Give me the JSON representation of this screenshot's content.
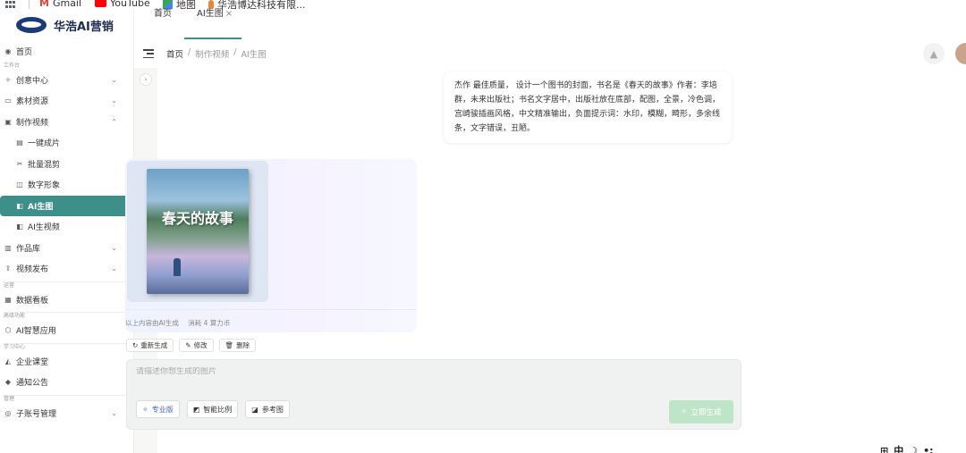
{
  "bookmarks": [
    {
      "label": "Gmail",
      "icon": "gmail-icon",
      "color": "#ea4335"
    },
    {
      "label": "YouTube",
      "icon": "youtube-icon",
      "color": "#ff0000"
    },
    {
      "label": "地图",
      "icon": "maps-icon",
      "color": "#34a853"
    },
    {
      "label": "华浩博达科技有限...",
      "icon": "bookmark-site-icon",
      "color": "#e8863a"
    }
  ],
  "brand": {
    "name": "华浩AI营销"
  },
  "sidebar": {
    "groups": {
      "workspace": "工作台",
      "operation": "运营",
      "advanced": "高级功能",
      "learning": "学习中心",
      "management": "管理"
    },
    "items": {
      "home": "首页",
      "creative": "创意中心",
      "assets": "素材资源",
      "video": "制作视频",
      "one_click": "一键成片",
      "batch_mix": "批量混剪",
      "digital_human": "数字形象",
      "ai_image": "AI生图",
      "ai_video": "AI生视频",
      "works": "作品库",
      "publish": "视频发布",
      "dashboard": "数据看板",
      "ai_apps": "AI智慧应用",
      "classroom": "企业课堂",
      "notice": "通知公告",
      "sub_accounts": "子账号管理"
    }
  },
  "tabs": {
    "home": "首页",
    "ai_image": "AI生图"
  },
  "breadcrumb": {
    "home": "首页",
    "video": "制作视频",
    "current": "AI生图"
  },
  "prompt_text": "杰作 最佳质量， 设计一个图书的封面，书名是《春天的故事》作者：李培群，未来出版社；书名文字居中，出版社放在底部，配图，全景，冷色调，宫崎骏插画风格，中文精准输出，负面提示词：水印，模糊，畸形，多余线条，文字错误，丑陋。",
  "result": {
    "cover_title": "春天的故事",
    "note": "以上内容由AI生成",
    "cost": "消耗 4 算力币"
  },
  "actions": {
    "regenerate": "重新生成",
    "edit": "修改",
    "delete": "删除"
  },
  "composer": {
    "placeholder": "请描述你想生成的图片",
    "pro": "专业版",
    "ratio": "智能比例",
    "reference": "参考图",
    "generate": "立即生成"
  },
  "ime": {
    "label": "中"
  },
  "colors": {
    "accent": "#3d8f8a",
    "generate_disabled": "#bfe5c8",
    "pro_text": "#4a5ccc"
  }
}
